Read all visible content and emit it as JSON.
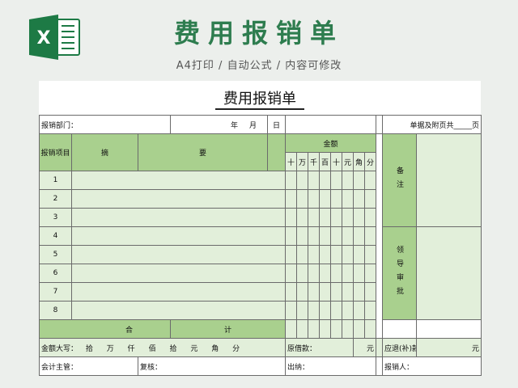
{
  "header": {
    "title": "费用报销单",
    "subtitle": "A4打印 / 自动公式 / 内容可修改",
    "logo_letter": "X"
  },
  "sheet": {
    "title": "费用报销单",
    "dept_label": "报销部门：",
    "date_year": "年",
    "date_month": "月",
    "date_day": "日",
    "attach_label": "单据及附页共_____页",
    "item_header": "报销项目",
    "summary_header_1": "摘",
    "summary_header_2": "要",
    "amount_header": "金额",
    "digits": [
      "十",
      "万",
      "千",
      "百",
      "十",
      "元",
      "角",
      "分"
    ],
    "remark_label": "备注",
    "approve_label": "领导审批",
    "rows": [
      "1",
      "2",
      "3",
      "4",
      "5",
      "6",
      "7",
      "8"
    ],
    "total_1": "合",
    "total_2": "计",
    "capital_label": "金额大写：",
    "capital_units": [
      "拾",
      "万",
      "仟",
      "佰",
      "拾",
      "元",
      "角",
      "分"
    ],
    "loan_label": "原借款：",
    "loan_unit": "元",
    "refund_label": "应退(补)款：",
    "refund_unit": "元",
    "accountant_label": "会计主管：",
    "review_label": "复核：",
    "cashier_label": "出纳：",
    "claimant_label": "报销人："
  },
  "colors": {
    "brand_green": "#2e7d4f",
    "header_green": "#a9d08e",
    "light_green": "#e2efda"
  }
}
